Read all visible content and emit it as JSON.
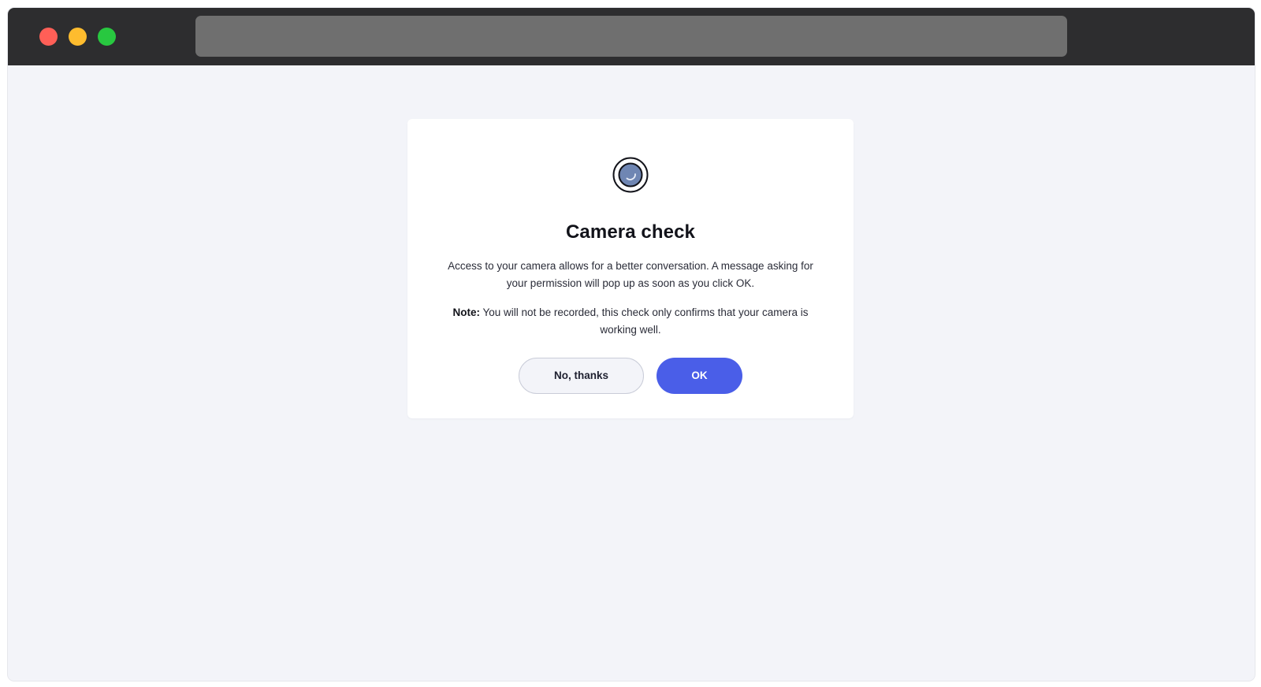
{
  "dialog": {
    "icon": "camera-icon",
    "title": "Camera check",
    "message": "Access to your camera allows for a better conversation. A message asking for your permission will pop up as soon as you click OK.",
    "note_label": "Note:",
    "note_text": " You will not be recorded, this check only confirms that your camera is working well.",
    "decline_label": "No, thanks",
    "accept_label": "OK"
  },
  "colors": {
    "accent": "#4a5ee8",
    "background": "#f3f4f9",
    "titlebar": "#2d2d2f"
  }
}
